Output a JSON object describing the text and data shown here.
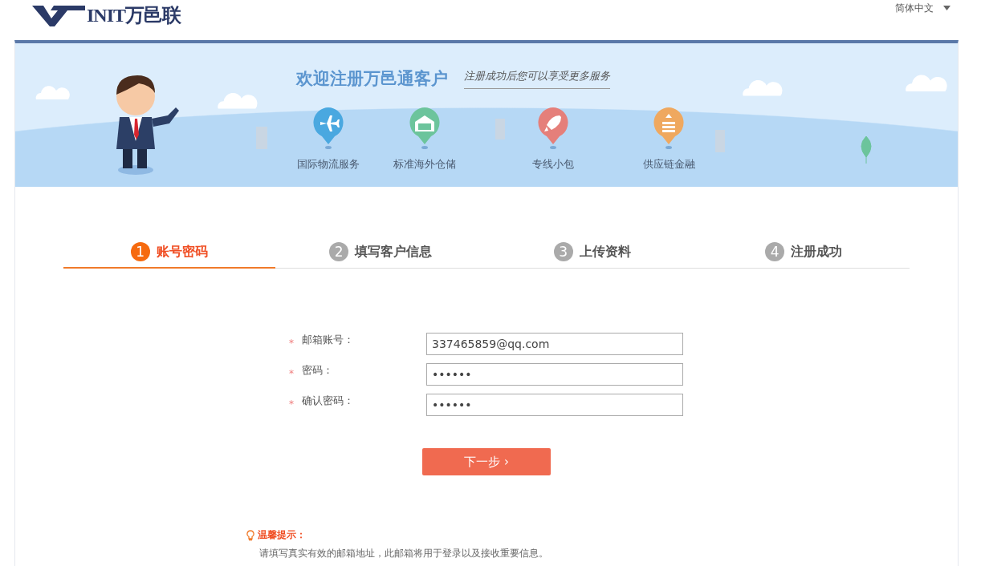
{
  "header": {
    "logo_text": "INIT万邑联",
    "language": "简体中文"
  },
  "banner": {
    "title": "欢迎注册万邑通客户",
    "slogan": "注册成功后您可以享受更多服务",
    "services": [
      {
        "label": "国际物流服务",
        "kind": "plane",
        "color": "#4aa8e0"
      },
      {
        "label": "标准海外仓储",
        "kind": "warehouse",
        "color": "#6cc49c"
      },
      {
        "label": "专线小包",
        "kind": "rocket",
        "color": "#e57f7a"
      },
      {
        "label": "供应链金融",
        "kind": "coins",
        "color": "#efa85f"
      }
    ]
  },
  "steps": [
    {
      "number": "1",
      "label": "账号密码",
      "selected": true
    },
    {
      "number": "2",
      "label": "填写客户信息",
      "selected": false
    },
    {
      "number": "3",
      "label": "上传资料",
      "selected": false
    },
    {
      "number": "4",
      "label": "注册成功",
      "selected": false
    }
  ],
  "form": {
    "fields": [
      {
        "required": "*",
        "label": "邮箱账号：",
        "value": "337465859@qq.com"
      },
      {
        "required": "*",
        "label": "密码：",
        "value": "••••••"
      },
      {
        "required": "*",
        "label": "确认密码：",
        "value": "••••••"
      }
    ],
    "next_button": "下一步 ›"
  },
  "tip": {
    "title": "温馨提示：",
    "text": "请填写真实有效的邮箱地址，此邮箱将用于登录以及接收重要信息。"
  }
}
